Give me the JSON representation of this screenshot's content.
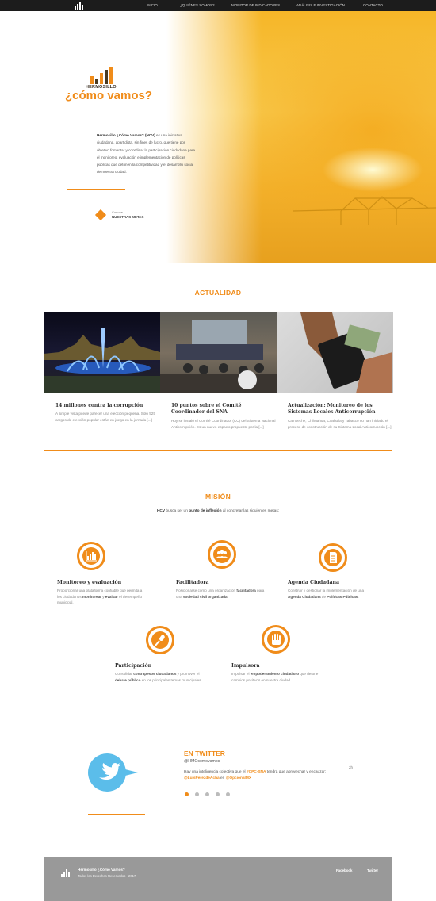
{
  "nav": {
    "items": [
      "INICIO",
      "¿QUIÉNES SOMOS?",
      "MONITOR DE INDICADORES",
      "ANÁLISIS E INVESTIGACIÓN",
      "CONTACTO"
    ]
  },
  "hero": {
    "logo_sub": "HERMOSILLO",
    "logo_main": "¿cómo vamos?",
    "desc_bold": "Hermosillo ¿Cómo Vamos? (HCV)",
    "desc_rest": " es una iniciativa ciudadana, apartidista, sin fines de lucro, que tiene por objetivo fomentar y coordinar la participación ciudadana para el monitoreo, evaluación e implementación de políticas públicas que detonen la competitividad y el desarrollo social de nuestra ciudad.",
    "goals_small": "Conoce",
    "goals_big": "NUESTRAS METAS"
  },
  "news": {
    "title": "ACTUALIDAD",
    "items": [
      {
        "title": "14 millones contra la corrupción",
        "text": "A simple vista puede parecer una elección pequeña. Sólo 525 cargos de elección popular están en juego en la jornada [...]"
      },
      {
        "title": "10 puntos sobre el Comité Coordinador del SNA",
        "text": "Hoy se instaló el Comité Coordinador (CC) del Sistema Nacional Anticorrupción. Es un nuevo espacio propuesto por la [...]"
      },
      {
        "title": "Actualización: Monitoreo de los Sistemas Locales Anticorrupción",
        "text": "Campeche, Chihuahua, Coahuila y Tabasco no han iniciado el proceso de construcción de su Sistema Local Anticorrupción [...]"
      }
    ]
  },
  "mission": {
    "title": "MISIÓN",
    "intro_a": "HCV",
    "intro_b": " busca ser un ",
    "intro_c": "punto de inflexión",
    "intro_d": " al concretar las siguientes metas:",
    "items": [
      {
        "title": "Monitoreo y evaluación",
        "text_a": "Proporcionar una plataforma confiable que permita a los ciudadanos ",
        "text_b": "monitorear",
        "text_c": " y ",
        "text_d": "evaluar",
        "text_e": " el desempeño municipal."
      },
      {
        "title": "Facilitadora",
        "text_a": "Posicionarse como una organización ",
        "text_b": "facilitadora",
        "text_c": " para una ",
        "text_d": "sociedad civil organizada",
        "text_e": "."
      },
      {
        "title": "Agenda Ciudadana",
        "text_a": "Construir y gestionar la implementación de una ",
        "text_b": "Agenda Ciudadana",
        "text_c": " de ",
        "text_d": "Políticas Públicas",
        "text_e": "."
      },
      {
        "title": "Participación",
        "text_a": "Consolidar ",
        "text_b": "contrapesos ciudadanos",
        "text_c": " y promover el ",
        "text_d": "debate público",
        "text_e": " en los principales temas municipales."
      },
      {
        "title": "Impulsora",
        "text_a": "Impulsar el ",
        "text_b": "empoderamiento ciudadano",
        "text_c": " que detone cambios positivos en nuestra ciudad.",
        "text_d": "",
        "text_e": ""
      }
    ]
  },
  "twitter": {
    "heading": "EN TWITTER",
    "handle": "@HMOcomovamos",
    "text_a": "Hay una inteligencia colectiva que el ",
    "text_b": "#CPC-SNA",
    "text_c": " tendrá que aprovechar y encauzar: ",
    "text_d": "@LuisPerezdeAcha",
    "text_e": " en ",
    "text_f": "@OpcionalMX",
    "time": "2h"
  },
  "footer": {
    "name": "Hermosillo ¿Cómo Vamos?",
    "copy": "Todos los Derechos Reservados · 2017",
    "links": [
      "Facebook",
      "Twitter"
    ]
  },
  "colors": {
    "accent": "#f08c1a",
    "twitter": "#5bbdea",
    "nav": "#1c1c1c",
    "footer": "#999999"
  }
}
